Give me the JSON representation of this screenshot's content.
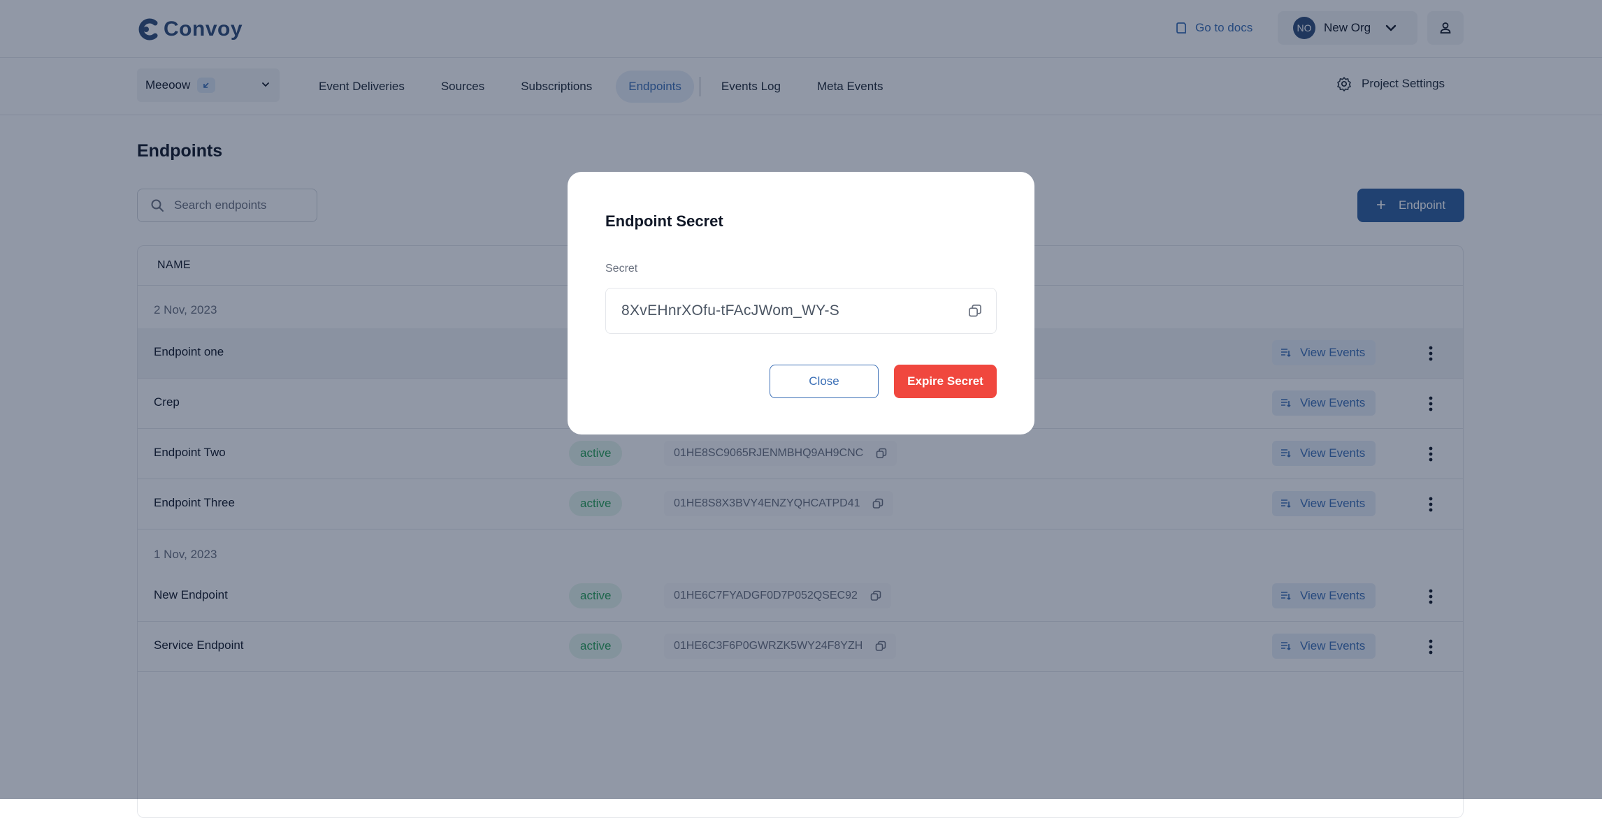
{
  "brand": {
    "name": "Convoy",
    "color": "#2f4c78"
  },
  "header": {
    "docs_label": "Go to docs",
    "org": {
      "initials": "NO",
      "name": "New Org"
    }
  },
  "nav": {
    "project": "Meeoow",
    "tabs": [
      "Event Deliveries",
      "Sources",
      "Subscriptions",
      "Endpoints",
      "Events Log",
      "Meta Events"
    ],
    "active_tab": "Endpoints",
    "settings_label": "Project Settings"
  },
  "page": {
    "title": "Endpoints",
    "search_placeholder": "Search endpoints",
    "add_button": "Endpoint",
    "column_name": "NAME"
  },
  "groups": [
    {
      "date": "2 Nov, 2023",
      "endpoints": [
        {
          "name": "Endpoint one",
          "status": "",
          "uid": "",
          "action": "View Events"
        },
        {
          "name": "Crep",
          "status": "",
          "uid": "",
          "action": "View Events"
        },
        {
          "name": "Endpoint Two",
          "status": "active",
          "uid": "01HE8SC9065RJENMBHQ9AH9CNC",
          "action": "View Events"
        },
        {
          "name": "Endpoint Three",
          "status": "active",
          "uid": "01HE8S8X3BVY4ENZYQHCATPD41",
          "action": "View Events"
        }
      ]
    },
    {
      "date": "1 Nov, 2023",
      "endpoints": [
        {
          "name": "New Endpoint",
          "status": "active",
          "uid": "01HE6C7FYADGF0D7P052QSEC92",
          "action": "View Events"
        },
        {
          "name": "Service Endpoint",
          "status": "active",
          "uid": "01HE6C3F6P0GWRZK5WY24F8YZH",
          "action": "View Events"
        }
      ]
    }
  ],
  "modal": {
    "title": "Endpoint Secret",
    "secret_label": "Secret",
    "secret_value": "8XvEHnrXOfu-tFAcJWom_WY-S",
    "close_label": "Close",
    "expire_label": "Expire Secret"
  },
  "colors": {
    "primary": "#2f5f9e",
    "link": "#3b6fb6",
    "danger": "#f0473e",
    "success": "#25a255",
    "overlay": "rgba(15,30,60,0.46)"
  },
  "icons": [
    "book-icon",
    "chevron-down-icon",
    "user-icon",
    "arrow-badge-icon",
    "gear-icon",
    "search-icon",
    "plus-icon",
    "copy-icon",
    "events-list-icon",
    "kebab-icon"
  ]
}
